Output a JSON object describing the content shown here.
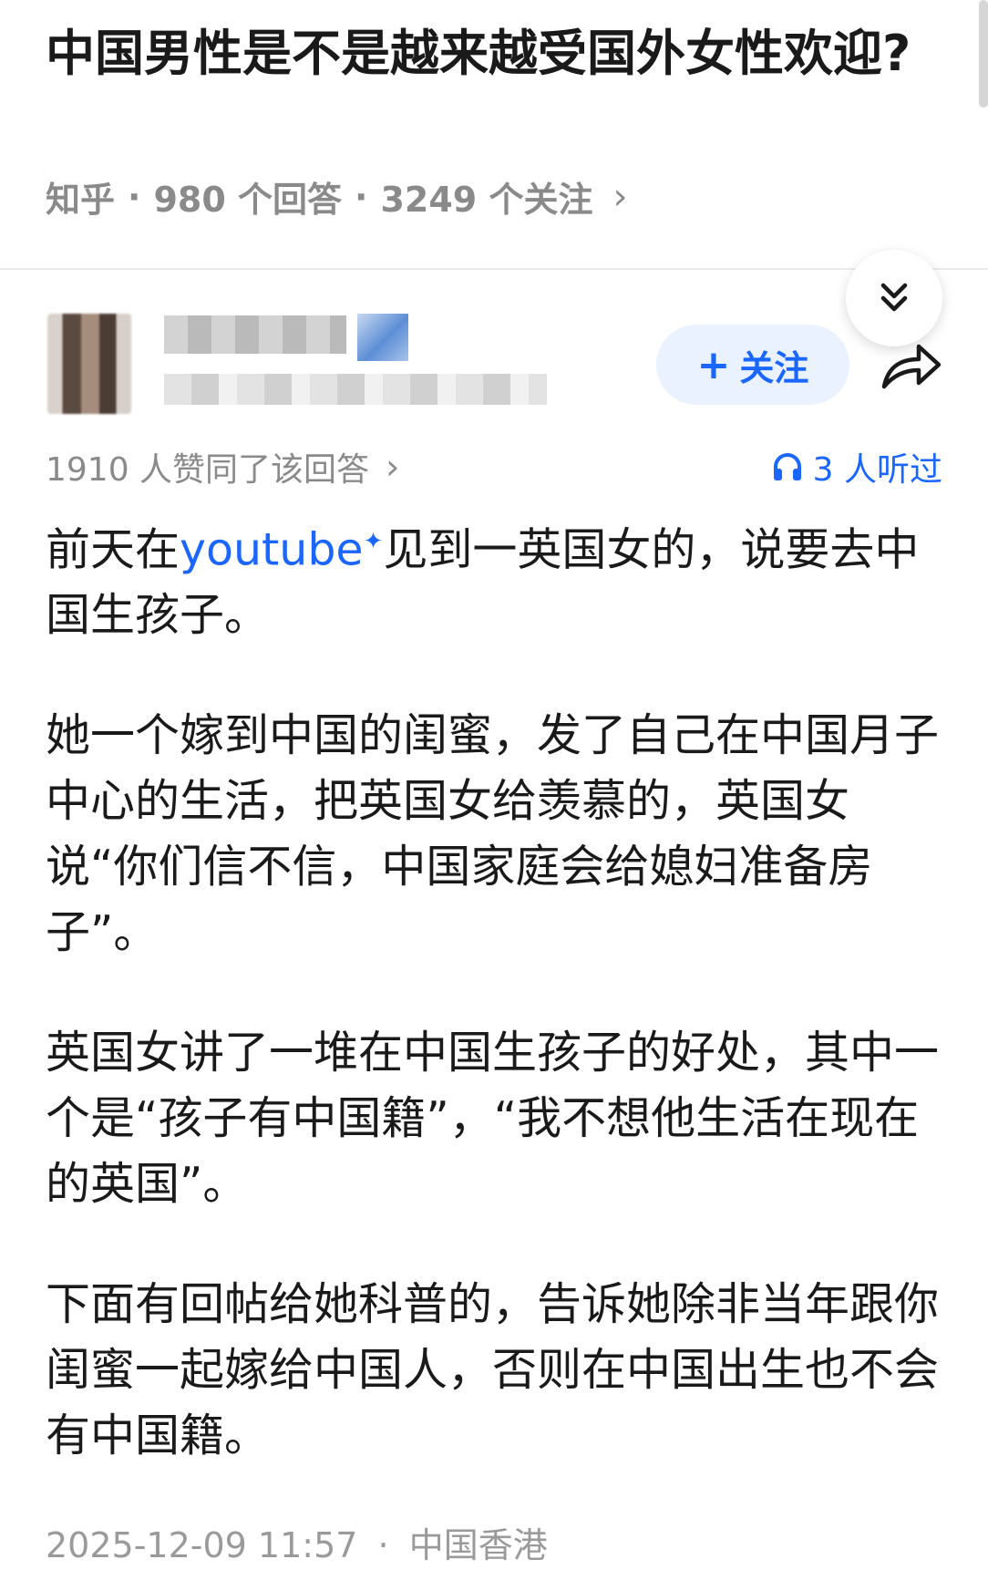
{
  "question": {
    "title": "中国男性是不是越来越受国外女性欢迎?",
    "source": "知乎",
    "answers": "980 个回答",
    "followers": "3249 个关注",
    "separator": "·",
    "chevron": "›"
  },
  "author": {
    "follow_plus": "+",
    "follow_label": "关注"
  },
  "answer": {
    "votes": "1910 人赞同了该回答",
    "votes_chevron": "›",
    "listened": "3 人听过",
    "p1_before": "前天在",
    "p1_link": "youtube",
    "p1_link_mark": "✦",
    "p1_after": "见到一英国女的，说要去中国生孩子。",
    "p2": "她一个嫁到中国的闺蜜，发了自己在中国月子中心的生活，把英国女给羡慕的，英国女说“你们信不信，中国家庭会给媳妇准备房子”。",
    "p3": "英国女讲了一堆在中国生孩子的好处，其中一个是“孩子有中国籍”，“我不想他生活在现在的英国”。",
    "p4": "下面有回帖给她科普的，告诉她除非当年跟你闺蜜一起嫁给中国人，否则在中国出生也不会有中国籍。",
    "datetime": "2025-12-09 11:57",
    "location": "中国香港",
    "separator": "·"
  },
  "icons": {
    "collapse": "double-chevron-down-icon",
    "share": "share-arrow-icon",
    "headphones": "headphones-icon"
  },
  "colors": {
    "accent": "#1a66ff",
    "follow_bg": "#eaf2ff",
    "meta_gray": "#8a8a8a"
  }
}
